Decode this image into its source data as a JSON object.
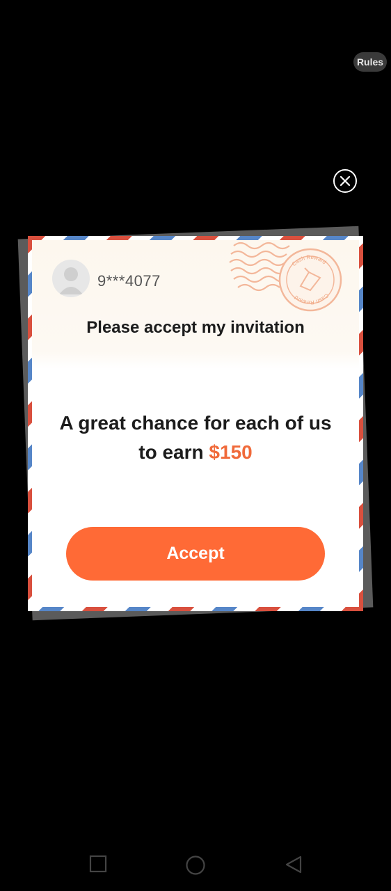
{
  "header": {
    "rules_label": "Rules"
  },
  "stamp": {
    "text_top": "Cash Reward",
    "text_bottom": "Cash Reward"
  },
  "invitation": {
    "sender": "9***4077",
    "title": "Please accept my invitation",
    "offer_text": "A great chance for each of us to earn",
    "offer_amount": "$150",
    "accept_label": "Accept"
  },
  "colors": {
    "accent": "#ff6a36",
    "stripe_red": "#d9503e",
    "stripe_blue": "#5686c8"
  },
  "icons": [
    "close-icon",
    "avatar-icon",
    "stamp-icon",
    "nav-recent-icon",
    "nav-home-icon",
    "nav-back-icon"
  ]
}
